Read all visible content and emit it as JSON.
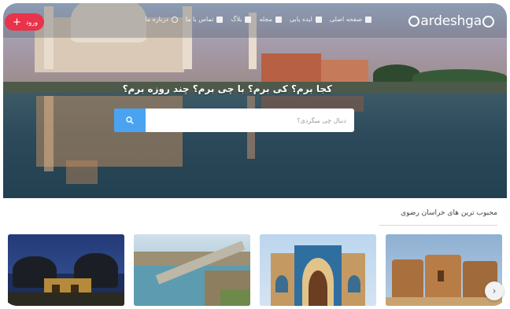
{
  "brand": {
    "name": "Gardeshgaran",
    "logo_text": "ardeshga"
  },
  "header": {
    "nav": [
      {
        "label": "صفحه اصلی",
        "icon": "home-icon"
      },
      {
        "label": "ایده یابی",
        "icon": "lightbulb-icon"
      },
      {
        "label": "مجله",
        "icon": "book-icon"
      },
      {
        "label": "بلاگ",
        "icon": "pen-icon"
      },
      {
        "label": "تماس با ما",
        "icon": "phone-icon"
      },
      {
        "label": "درباره ما",
        "icon": "info-icon"
      }
    ],
    "login_label": "ورود"
  },
  "hero": {
    "tagline": "کجا برم؟ کی برم؟ با چی برم؟ چند روزه برم؟",
    "search_placeholder": "دنبال چی میگردی؟"
  },
  "section": {
    "title": "محبوب ترین های خراسان رضوی",
    "cards": [
      {
        "name": "shrine-night"
      },
      {
        "name": "dam-lake"
      },
      {
        "name": "mosque-portal"
      },
      {
        "name": "mud-fortress"
      }
    ]
  },
  "colors": {
    "accent": "#e9334a",
    "search_button": "#4aa3f1"
  }
}
